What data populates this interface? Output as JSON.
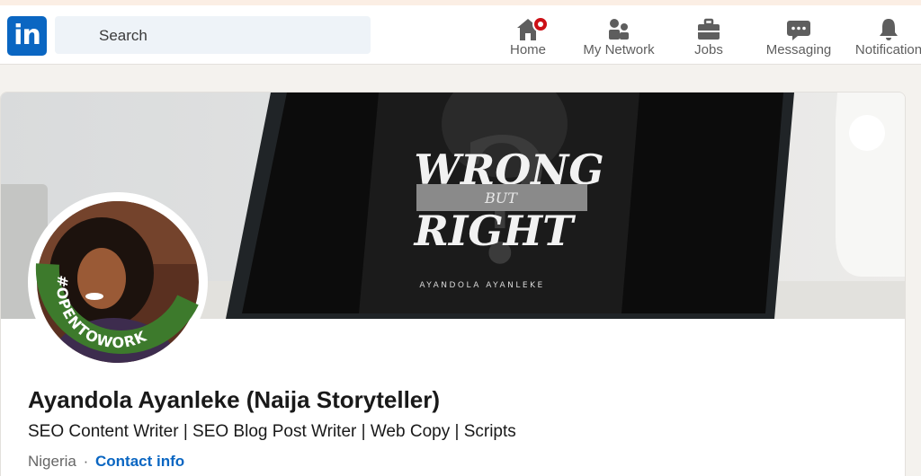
{
  "nav": {
    "search_placeholder": "Search",
    "items": [
      {
        "label": "Home",
        "icon": "home-icon",
        "has_badge": true
      },
      {
        "label": "My Network",
        "icon": "network-icon"
      },
      {
        "label": "Jobs",
        "icon": "briefcase-icon"
      },
      {
        "label": "Messaging",
        "icon": "chat-icon"
      },
      {
        "label": "Notification",
        "icon": "bell-icon"
      }
    ]
  },
  "cover": {
    "title_top": "WRONG",
    "title_mid": "BUT",
    "title_bottom": "RIGHT",
    "author": "AYANDOLA AYANLEKE"
  },
  "avatar": {
    "frame_text": "#OPENTOWORK",
    "frame_color": "#3d7a2c"
  },
  "profile": {
    "name": "Ayandola Ayanleke (Naija Storyteller)",
    "headline": "SEO Content Writer | SEO Blog Post Writer | Web Copy | Scripts",
    "location": "Nigeria",
    "separator": "·",
    "contact_label": "Contact info"
  },
  "colors": {
    "brand": "#0a66c2",
    "badge": "#cc1016",
    "nav_icon": "#5e5e5e"
  }
}
